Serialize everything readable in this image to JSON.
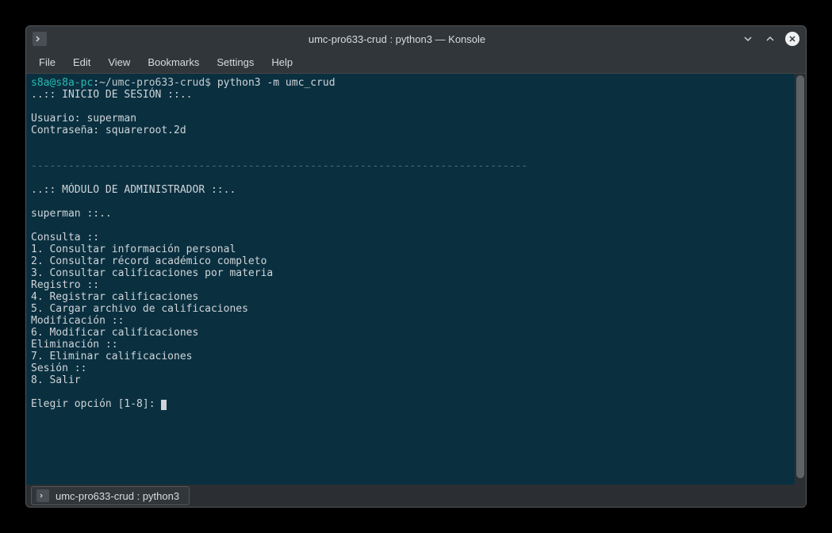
{
  "window": {
    "title": "umc-pro633-crud : python3 — Konsole"
  },
  "menubar": {
    "items": [
      "File",
      "Edit",
      "View",
      "Bookmarks",
      "Settings",
      "Help"
    ]
  },
  "terminal": {
    "prompt_user": "s8a@s8a-pc",
    "prompt_sep": ":",
    "prompt_path": "~/umc-pro633-crud$",
    "command": " python3 -m umc_crud",
    "lines": {
      "l1": "..:: INICIO DE SESIÓN ::..",
      "l2": "",
      "l3": "Usuario: superman",
      "l4": "Contraseña: squareroot.2d",
      "l5": "",
      "l6": "",
      "l7": "--------------------------------------------------------------------------------",
      "l8": "",
      "l9": "..:: MÓDULO DE ADMINISTRADOR ::..",
      "l10": "",
      "l11": "superman ::..",
      "l12": "",
      "l13": "Consulta ::",
      "l14": "1. Consultar información personal",
      "l15": "2. Consultar récord académico completo",
      "l16": "3. Consultar calificaciones por materia",
      "l17": "Registro ::",
      "l18": "4. Registrar calificaciones",
      "l19": "5. Cargar archivo de calificaciones",
      "l20": "Modificación ::",
      "l21": "6. Modificar calificaciones",
      "l22": "Eliminación ::",
      "l23": "7. Eliminar calificaciones",
      "l24": "Sesión ::",
      "l25": "8. Salir",
      "l26": "",
      "l27": "Elegir opción [1-8]: "
    }
  },
  "tab": {
    "label": "umc-pro633-crud : python3"
  }
}
